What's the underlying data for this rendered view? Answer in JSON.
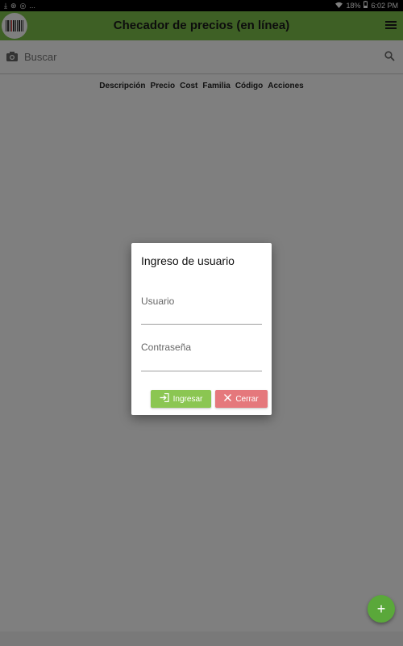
{
  "status_bar": {
    "left_text": "...",
    "battery": "18%",
    "time": "6:02 PM"
  },
  "app_bar": {
    "title": "Checador de precios (en línea)"
  },
  "search": {
    "placeholder": "Buscar"
  },
  "table": {
    "columns": [
      "Descripción",
      "Precio",
      "Cost",
      "Familia",
      "Código",
      "Acciones"
    ]
  },
  "fab": {
    "label": "+"
  },
  "dialog": {
    "title": "Ingreso de usuario",
    "username_label": "Usuario",
    "username_value": "",
    "password_label": "Contraseña",
    "password_value": "",
    "login_label": "Ingresar",
    "close_label": "Cerrar"
  },
  "colors": {
    "app_bar": "#7cc04b",
    "login_button": "#8bc652",
    "close_button": "#e5787c",
    "fab": "#5aa83a"
  }
}
